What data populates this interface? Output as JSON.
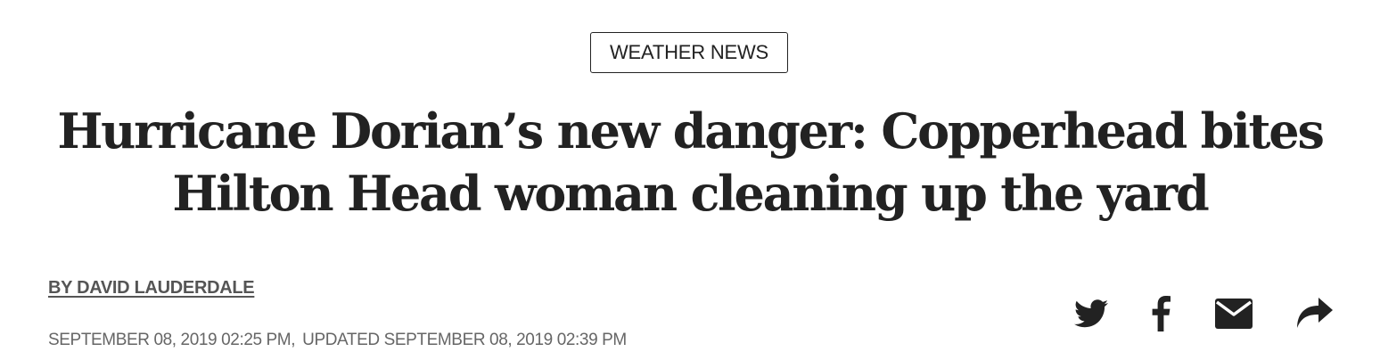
{
  "article": {
    "section_label": "WEATHER NEWS",
    "headline": "Hurricane Dorian’s new danger: Copperhead bites Hilton Head woman cleaning up the yard",
    "byline": "BY DAVID LAUDERDALE",
    "published": "SEPTEMBER 08, 2019 02:25 PM,",
    "updated": "UPDATED SEPTEMBER 08, 2019 02:39 PM"
  },
  "share": {
    "icons": [
      "twitter-icon",
      "facebook-icon",
      "email-icon",
      "share-arrow-icon"
    ]
  },
  "colors": {
    "text": "#222222",
    "byline": "#555555",
    "meta": "#666666"
  }
}
